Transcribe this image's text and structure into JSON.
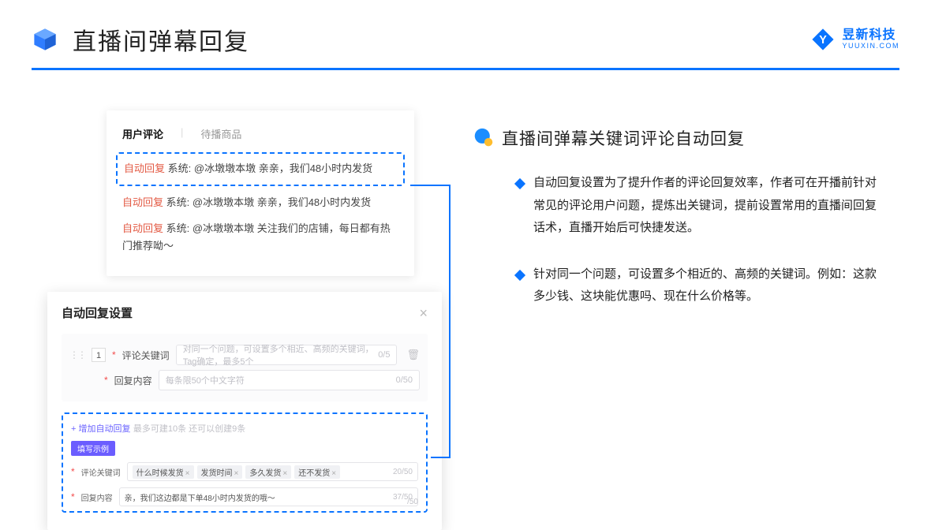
{
  "header": {
    "title": "直播间弹幕回复",
    "brand_name": "昱新科技",
    "brand_domain": "YUUXIN.COM"
  },
  "comments_card": {
    "tab_active": "用户评论",
    "tab_other": "待播商品",
    "items": [
      {
        "label": "自动回复",
        "sys": "系统:",
        "text": "@冰墩墩本墩 亲亲，我们48小时内发货"
      },
      {
        "label": "自动回复",
        "sys": "系统:",
        "text": "@冰墩墩本墩 亲亲，我们48小时内发货"
      },
      {
        "label": "自动回复",
        "sys": "系统:",
        "text": "@冰墩墩本墩 关注我们的店铺，每日都有热门推荐呦～"
      }
    ]
  },
  "settings_card": {
    "title": "自动回复设置",
    "index": "1",
    "keyword_label": "评论关键词",
    "keyword_placeholder": "对同一个问题，可设置多个相近、高频的关键词，Tag确定，最多5个",
    "keyword_count": "0/5",
    "content_label": "回复内容",
    "content_placeholder": "每条限50个中文字符",
    "content_count": "0/50",
    "add_text": "+ 增加自动回复",
    "add_hint": "最多可建10条 还可以创建9条",
    "example_badge": "填写示例",
    "ex_keyword_label": "评论关键词",
    "ex_tags": [
      "什么时候发货",
      "发货时间",
      "多久发货",
      "还不发货"
    ],
    "ex_keyword_count": "20/50",
    "ex_content_label": "回复内容",
    "ex_content_value": "亲，我们这边都是下单48小时内发货的哦～",
    "ex_content_count": "37/50",
    "faint_count": "/50"
  },
  "right": {
    "heading": "直播间弹幕关键词评论自动回复",
    "bullet1": "自动回复设置为了提升作者的评论回复效率，作者可在开播前针对常见的评论用户问题，提炼出关键词，提前设置常用的直播间回复话术，直播开始后可快捷发送。",
    "bullet2": "针对同一个问题，可设置多个相近的、高频的关键词。例如：这款多少钱、这块能优惠吗、现在什么价格等。"
  }
}
